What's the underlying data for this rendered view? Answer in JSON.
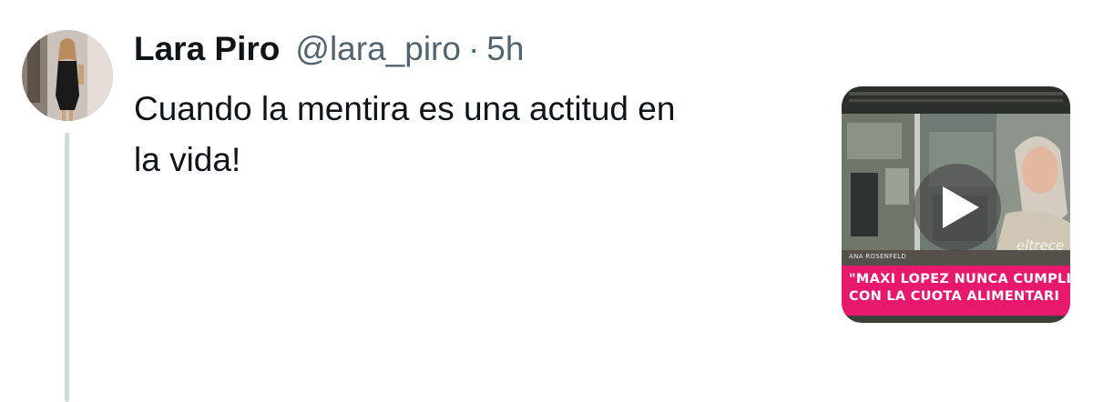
{
  "tweet": {
    "author_name": "Lara Piro",
    "handle": "@lara_piro",
    "separator": "·",
    "time": "5h",
    "text_line1": "Cuando la mentira es una actitud en",
    "text_line2": "la vida!"
  },
  "media": {
    "type": "video",
    "tv_name_caption": "ANA ROSENFELD",
    "channel_logo": "eltrece",
    "banner_line1": "\"MAXI LOPEZ NUNCA CUMPLI",
    "banner_line2": "CON LA CUOTA ALIMENTARI",
    "play_icon": "play-icon",
    "banner_color": "#e8196c"
  },
  "colors": {
    "text_primary": "#0f1419",
    "text_secondary": "#536471",
    "thread_line": "#cfd9de"
  }
}
